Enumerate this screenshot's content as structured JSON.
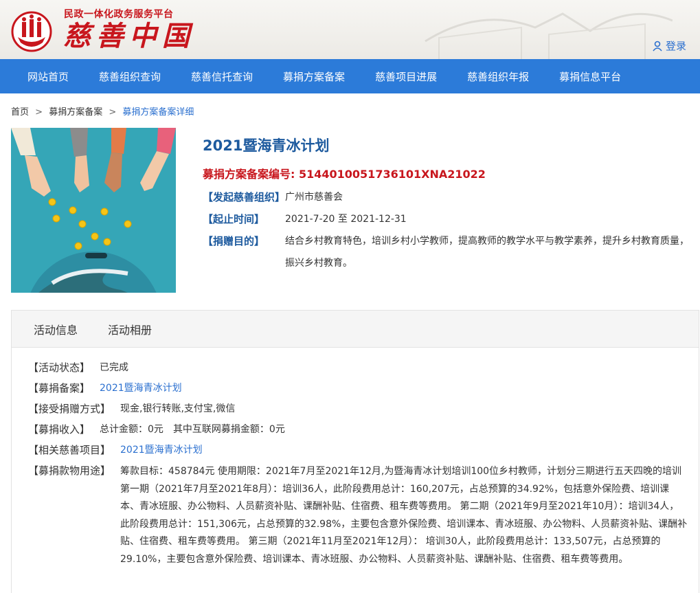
{
  "header": {
    "tagline": "民政一体化政务服务平台",
    "brand": "慈善中国",
    "login": "登录"
  },
  "nav": [
    "网站首页",
    "慈善组织查询",
    "慈善信托查询",
    "募捐方案备案",
    "慈善项目进展",
    "慈善组织年报",
    "募捐信息平台"
  ],
  "breadcrumb": {
    "home": "首页",
    "level1": "募捐方案备案",
    "level2": "募捐方案备案详细",
    "sep": ">"
  },
  "plan": {
    "title": "2021暨海青冰计划",
    "code_label": "募捐方案备案编号:",
    "code": "5144010051736101XNA21022",
    "org_label": "【发起慈善组织】",
    "org": "广州市慈善会",
    "period_label": "【起止时间】",
    "period": "2021-7-20 至 2021-12-31",
    "purpose_label": "【捐赠目的】",
    "purpose": "结合乡村教育特色，培训乡村小学教师，提高教师的教学水平与教学素养，提升乡村教育质量，振兴乡村教育。"
  },
  "tabs": [
    "活动信息",
    "活动相册"
  ],
  "details": {
    "status_label": "【活动状态】",
    "status": "已完成",
    "record_label": "【募捐备案】",
    "record": "2021暨海青冰计划",
    "method_label": "【接受捐赠方式】",
    "method": "现金,银行转账,支付宝,微信",
    "income_label": "【募捐收入】",
    "income_total": "总计金额：0元",
    "income_online": "其中互联网募捐金额：0元",
    "project_label": "【相关慈善项目】",
    "project": "2021暨海青冰计划",
    "usage_label": "【募捐款物用途】",
    "usage": "筹款目标：458784元 使用期限：2021年7月至2021年12月,为暨海青冰计划培训100位乡村教师，计划分三期进行五天四晚的培训 第一期（2021年7月至2021年8月）：培训36人，此阶段费用总计：160,207元，占总预算的34.92%，包括意外保险费、培训课本、青冰班服、办公物料、人员薪资补贴、课酬补贴、住宿费、租车费等费用。 第二期（2021年9月至2021年10月）：培训34人，此阶段费用总计：151,306元，占总预算的32.98%，主要包含意外保险费、培训课本、青冰班服、办公物料、人员薪资补贴、课酬补贴、住宿费、租车费等费用。 第三期（2021年11月至2021年12月）： 培训30人，此阶段费用总计：133,507元，占总预算的29.10%，主要包含意外保险费、培训课本、青冰班服、办公物料、人员薪资补贴、课酬补贴、住宿费、租车费等费用。"
  },
  "colors": {
    "nav": "#2c7bd9",
    "brand_red": "#c8161d",
    "link_blue": "#2a6fcf",
    "label_blue": "#1d5a9e"
  }
}
